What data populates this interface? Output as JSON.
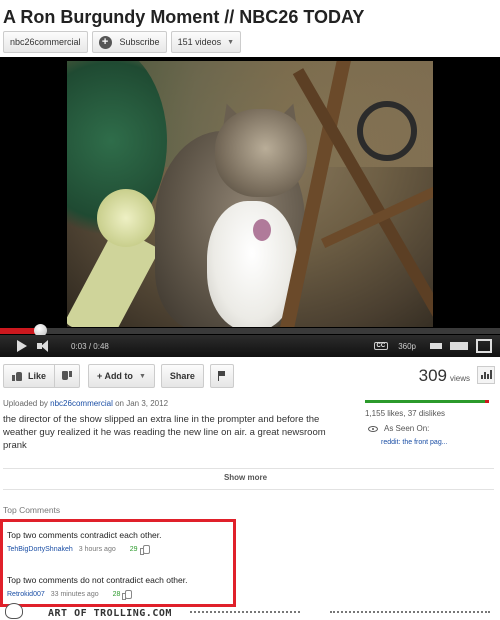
{
  "header": {
    "title": "A Ron Burgundy Moment // NBC26 TODAY",
    "channel_name": "nbc26commercial",
    "subscribe_label": "Subscribe",
    "videos_label": "151 videos"
  },
  "player": {
    "current_time": "0:03",
    "duration": "0:48",
    "time_separator": "/",
    "progress_fraction": 0.08,
    "cc_label": "CC",
    "quality_label": "360p"
  },
  "actions": {
    "like_label": "Like",
    "add_to_label": "+ Add to",
    "share_label": "Share"
  },
  "stats": {
    "views_count": "309",
    "views_label": "views",
    "likes_fraction": 0.97,
    "likes_dislikes_text": "1,155 likes, 37 dislikes"
  },
  "description": {
    "uploaded_prefix": "Uploaded by",
    "uploader": "nbc26commercial",
    "uploaded_date": "on Jan 3, 2012",
    "text": "the director of the show slipped an extra line in the prompter and before the weather guy realized it he was reading the new line on air. a great newsroom prank",
    "as_seen_on": "As Seen On:",
    "as_seen_link": "reddit: the front pag...",
    "show_more_label": "Show more"
  },
  "comments": {
    "heading": "Top Comments",
    "items": [
      {
        "text": "Top two comments contradict each other.",
        "author": "TehBigDortyShnakeh",
        "ago": "3 hours ago",
        "score": "29"
      },
      {
        "text": "Top two comments do not contradict each other.",
        "author": "Retrokid007",
        "ago": "33 minutes ago",
        "score": "28"
      }
    ]
  },
  "watermark": {
    "text": "ART OF TROLLING.COM"
  },
  "colors": {
    "highlight_border": "#e0202a",
    "progress_red": "#cc181e",
    "likes_green": "#2b9a2b",
    "link_blue": "#1a4ea5"
  },
  "icons": {
    "subscribe": "plus-circle-icon",
    "like": "thumbs-up-icon",
    "dislike": "thumbs-down-icon",
    "flag": "flag-icon",
    "stats": "bar-chart-icon",
    "seen": "eye-icon",
    "comment_vote": "thumbs-up-icon"
  }
}
